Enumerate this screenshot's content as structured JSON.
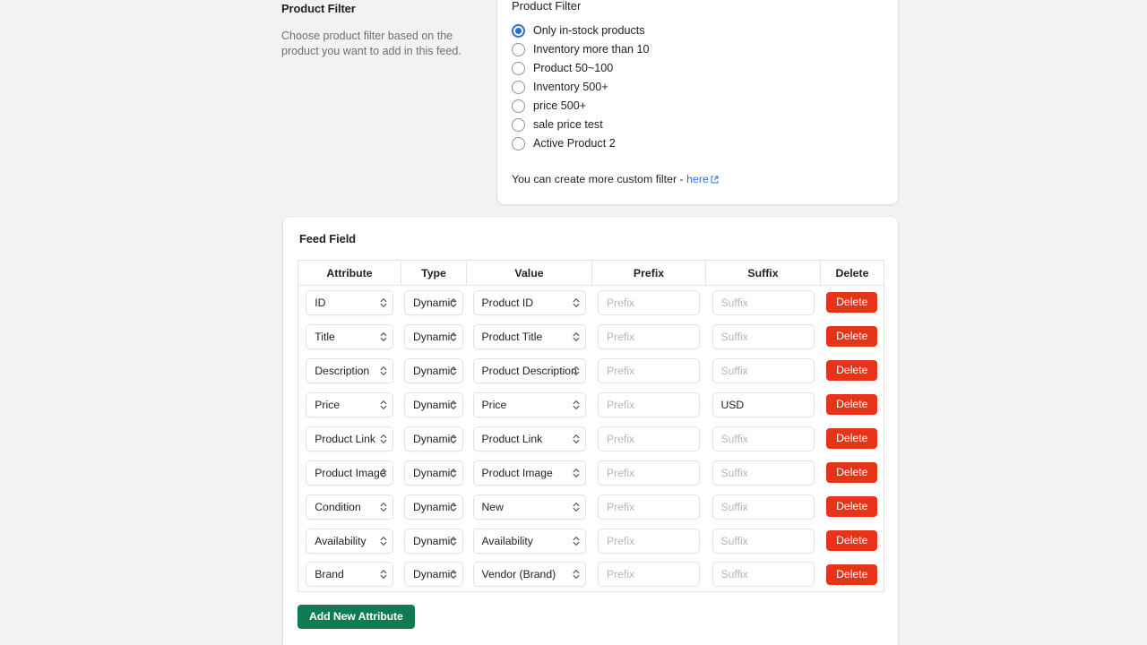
{
  "product_filter": {
    "heading": "Product Filter",
    "description": "Choose product filter based on the product you want to add in this feed.",
    "card_title": "Product Filter",
    "options": [
      {
        "label": "Only in-stock products",
        "selected": true
      },
      {
        "label": "Inventory more than 10",
        "selected": false
      },
      {
        "label": "Product 50~100",
        "selected": false
      },
      {
        "label": "Inventory 500+",
        "selected": false
      },
      {
        "label": "price 500+",
        "selected": false
      },
      {
        "label": "sale price test",
        "selected": false
      },
      {
        "label": "Active Product 2",
        "selected": false
      }
    ],
    "note_text": "You can create more custom filter - ",
    "note_link": "here",
    "note_link_icon": "external-link-icon"
  },
  "feed_field": {
    "heading": "Feed Field",
    "columns": [
      "Attribute",
      "Type",
      "Value",
      "Prefix",
      "Suffix",
      "Delete"
    ],
    "prefix_placeholder": "Prefix",
    "suffix_placeholder": "Suffix",
    "delete_label": "Delete",
    "add_button_label": "Add New Attribute",
    "rows": [
      {
        "attribute": "ID",
        "type": "Dynamic",
        "value": "Product ID",
        "prefix": "",
        "suffix": ""
      },
      {
        "attribute": "Title",
        "type": "Dynamic",
        "value": "Product Title",
        "prefix": "",
        "suffix": ""
      },
      {
        "attribute": "Description",
        "type": "Dynamic",
        "value": "Product Description",
        "prefix": "",
        "suffix": ""
      },
      {
        "attribute": "Price",
        "type": "Dynamic",
        "value": "Price",
        "prefix": "",
        "suffix": "USD"
      },
      {
        "attribute": "Product Link",
        "type": "Dynamic",
        "value": "Product Link",
        "prefix": "",
        "suffix": ""
      },
      {
        "attribute": "Product Image",
        "type": "Dynamic",
        "value": "Product Image",
        "prefix": "",
        "suffix": ""
      },
      {
        "attribute": "Condition",
        "type": "Dynamic",
        "value": "New",
        "prefix": "",
        "suffix": ""
      },
      {
        "attribute": "Availability",
        "type": "Dynamic",
        "value": "Availability",
        "prefix": "",
        "suffix": ""
      },
      {
        "attribute": "Brand",
        "type": "Dynamic",
        "value": "Vendor (Brand)",
        "prefix": "",
        "suffix": ""
      }
    ]
  },
  "colors": {
    "page_background": "#f1f2f4",
    "card_background": "#ffffff",
    "radio_selected": "#2c6ecb",
    "link": "#2c6ecb",
    "delete_button": "#e8331b",
    "add_button": "#107a53",
    "text_primary": "#202223",
    "text_muted": "#6d7175"
  }
}
